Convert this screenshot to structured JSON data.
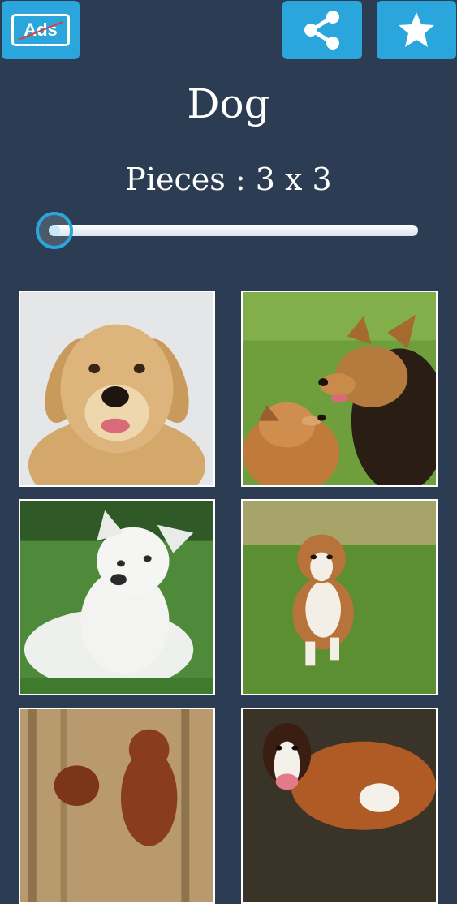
{
  "header": {
    "ads_label": "Ads",
    "share_icon": "share-icon",
    "favorite_icon": "star-icon"
  },
  "category": {
    "title": "Dog"
  },
  "pieces": {
    "label": "Pieces : 3 x 3",
    "rows": 3,
    "cols": 3,
    "slider_level": 0.02
  },
  "colors": {
    "background": "#2c3c52",
    "accent": "#2ba6dc"
  },
  "puzzles": [
    {
      "id": "golden-retriever"
    },
    {
      "id": "two-shepherd-dogs"
    },
    {
      "id": "white-dog-lying"
    },
    {
      "id": "collie-puppy"
    },
    {
      "id": "red-setters"
    },
    {
      "id": "saint-bernard"
    }
  ]
}
